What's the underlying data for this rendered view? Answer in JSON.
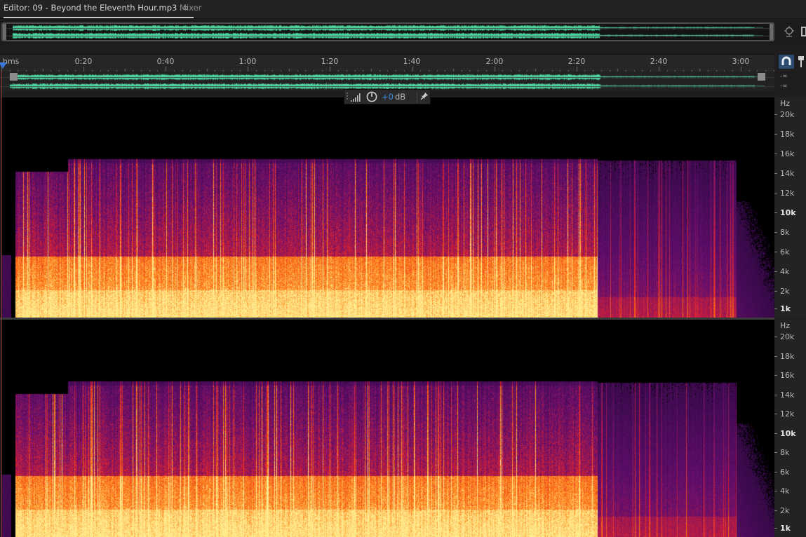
{
  "tabs": {
    "editor_label": "Editor: 09 - Beyond the Eleventh Hour.mp3",
    "editor_menu_glyph": "≡",
    "mixer_label": "Mixer"
  },
  "ruler": {
    "unit_label": "hms",
    "ticks": [
      "0:20",
      "0:40",
      "1:00",
      "1:20",
      "1:40",
      "2:00",
      "2:20",
      "2:40",
      "3:00"
    ]
  },
  "waveform": {
    "channels": [
      "left",
      "right"
    ],
    "db_labels": [
      "-∞",
      "-∞"
    ]
  },
  "hud": {
    "value": "+0",
    "unit": "dB"
  },
  "frequency_scale": {
    "unit": "Hz",
    "labels": [
      "20k",
      "18k",
      "16k",
      "14k",
      "12k",
      "10k",
      "8k",
      "6k",
      "4k",
      "2k",
      "1k"
    ],
    "bold_labels": [
      "10k",
      "1k"
    ]
  },
  "colors": {
    "waveform": "#4fd9a3",
    "spectrogram_low": "#2a0b3d",
    "spectrogram_mid": "#e0261b",
    "spectrogram_high": "#ffb347",
    "accent_blue": "#3d8ee8"
  },
  "icons": {
    "hud_meter": "level-meter-icon",
    "hud_knob": "volume-knob-icon",
    "hud_pin": "pin-icon",
    "snap": "snap-magnet-icon",
    "marker": "marker-icon",
    "overview_zoom": "zoom-navigator-icon"
  }
}
